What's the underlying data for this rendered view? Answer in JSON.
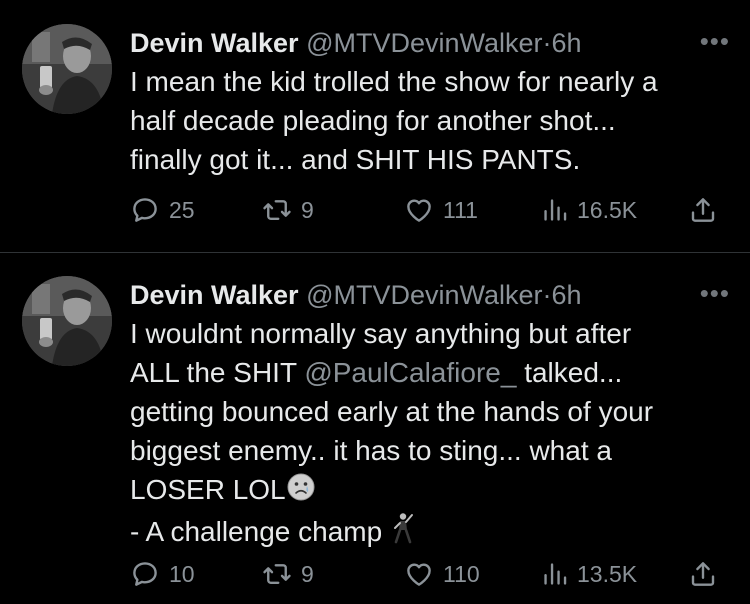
{
  "tweets": [
    {
      "author": "Devin Walker",
      "handle": "@MTVDevinWalker",
      "separator": "·",
      "time": "6h",
      "more_icon": "more-icon",
      "lines": [
        "I mean the kid trolled the show for nearly a",
        "half decade pleading for another shot...",
        "finally got it... and SHIT HIS PANTS."
      ],
      "replies": "25",
      "retweets": "9",
      "likes": "111",
      "views": "16.5K"
    },
    {
      "author": "Devin Walker",
      "handle": "@MTVDevinWalker",
      "separator": "·",
      "time": "6h",
      "more_icon": "more-icon",
      "line1": "I wouldnt normally say anything but after",
      "line2_before": "ALL the SHIT ",
      "line2_mention": "@PaulCalafiore_",
      "line2_after": " talked...",
      "line3": "getting bounced early at the hands of your",
      "line4": "biggest enemy.. it has to sting... what a",
      "line5": "LOSER LOL",
      "line5_emoji": "crying-face-emoji",
      "line6": "- A challenge champ ",
      "line6_emoji": "man-dancing-emoji",
      "replies": "10",
      "retweets": "9",
      "likes": "110",
      "views": "13.5K"
    }
  ],
  "colors": {
    "background": "#000000",
    "text": "#e7e9ea",
    "muted": "#8b9298",
    "divider": "#2f3336"
  },
  "icons": [
    "reply-icon",
    "retweet-icon",
    "like-icon",
    "views-icon",
    "share-icon",
    "more-icon"
  ]
}
